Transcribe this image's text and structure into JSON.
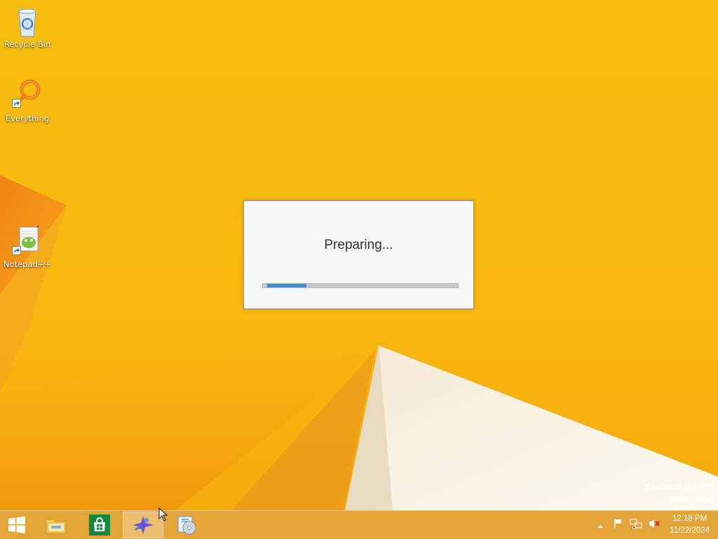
{
  "desktop": {
    "icons": [
      {
        "label": "Recycle Bin",
        "icon": "recycle-bin-icon"
      },
      {
        "label": "Everything",
        "icon": "everything-search-icon"
      },
      {
        "label": "Notepad++",
        "icon": "notepad-plus-plus-icon"
      }
    ],
    "watermark": {
      "line1": "Windows 8.1 Pro",
      "line2": "Build 9600"
    }
  },
  "dialog": {
    "message": "Preparing...",
    "progress": 0.2,
    "progress_color": "#3c8fe0"
  },
  "taskbar": {
    "buttons": [
      {
        "name": "start",
        "icon": "windows-logo-icon"
      },
      {
        "name": "file-explorer",
        "icon": "file-explorer-icon"
      },
      {
        "name": "store",
        "icon": "store-icon"
      },
      {
        "name": "installer-app",
        "icon": "installer-app-icon",
        "active": true
      },
      {
        "name": "setup-app",
        "icon": "setup-disc-icon"
      }
    ],
    "tray_icons": [
      "show-hidden-icons-icon",
      "action-center-flag-icon",
      "network-icon",
      "volume-muted-icon"
    ],
    "clock": {
      "time": "12:18 PM",
      "date": "11/22/2024"
    }
  },
  "colors": {
    "wallpaper": "#f6bd0e",
    "taskbar": "#e2a43c"
  }
}
